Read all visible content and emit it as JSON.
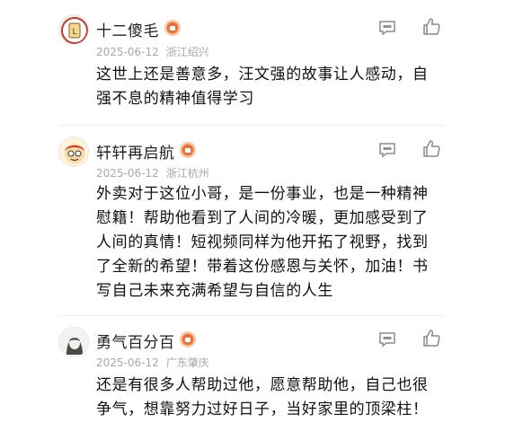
{
  "comments": [
    {
      "username": "十二傻毛",
      "date": "2025-06-12",
      "location": "浙江绍兴",
      "avatar_icon": "bus-stop-cartoon-avatar",
      "badge_icon": "level-badge-icon",
      "lines": [
        "这世上还是善意多，汪文强的故事让人感动，自",
        "强不息的精神值得学习"
      ]
    },
    {
      "username": "轩轩再启航",
      "date": "2025-06-12",
      "location": "浙江杭州",
      "avatar_icon": "cartoon-boy-avatar",
      "badge_icon": "level-badge-icon",
      "lines": [
        "外卖对于这位小哥，是一份事业，也是一种精神",
        "慰籍！帮助他看到了人间的冷暖，更加感受到了",
        "人间的真情！短视频同样为他开拓了视野，找到",
        "了全新的希望！带着这份感恩与关怀，加油！书",
        "写自己未来充满希望与自信的人生"
      ]
    },
    {
      "username": "勇气百分百",
      "date": "2025-06-12",
      "location": "广东肇庆",
      "avatar_icon": "sketch-girl-avatar",
      "badge_icon": "level-badge-icon",
      "lines": [
        "还是有很多人帮助过他，愿意帮助他，自己也很",
        "争气，想靠努力过好日子，当好家里的顶梁柱！"
      ]
    }
  ],
  "colors": {
    "meta": "#a8a8a8",
    "badge": "#e8743b",
    "icon": "#8a8a8a"
  }
}
